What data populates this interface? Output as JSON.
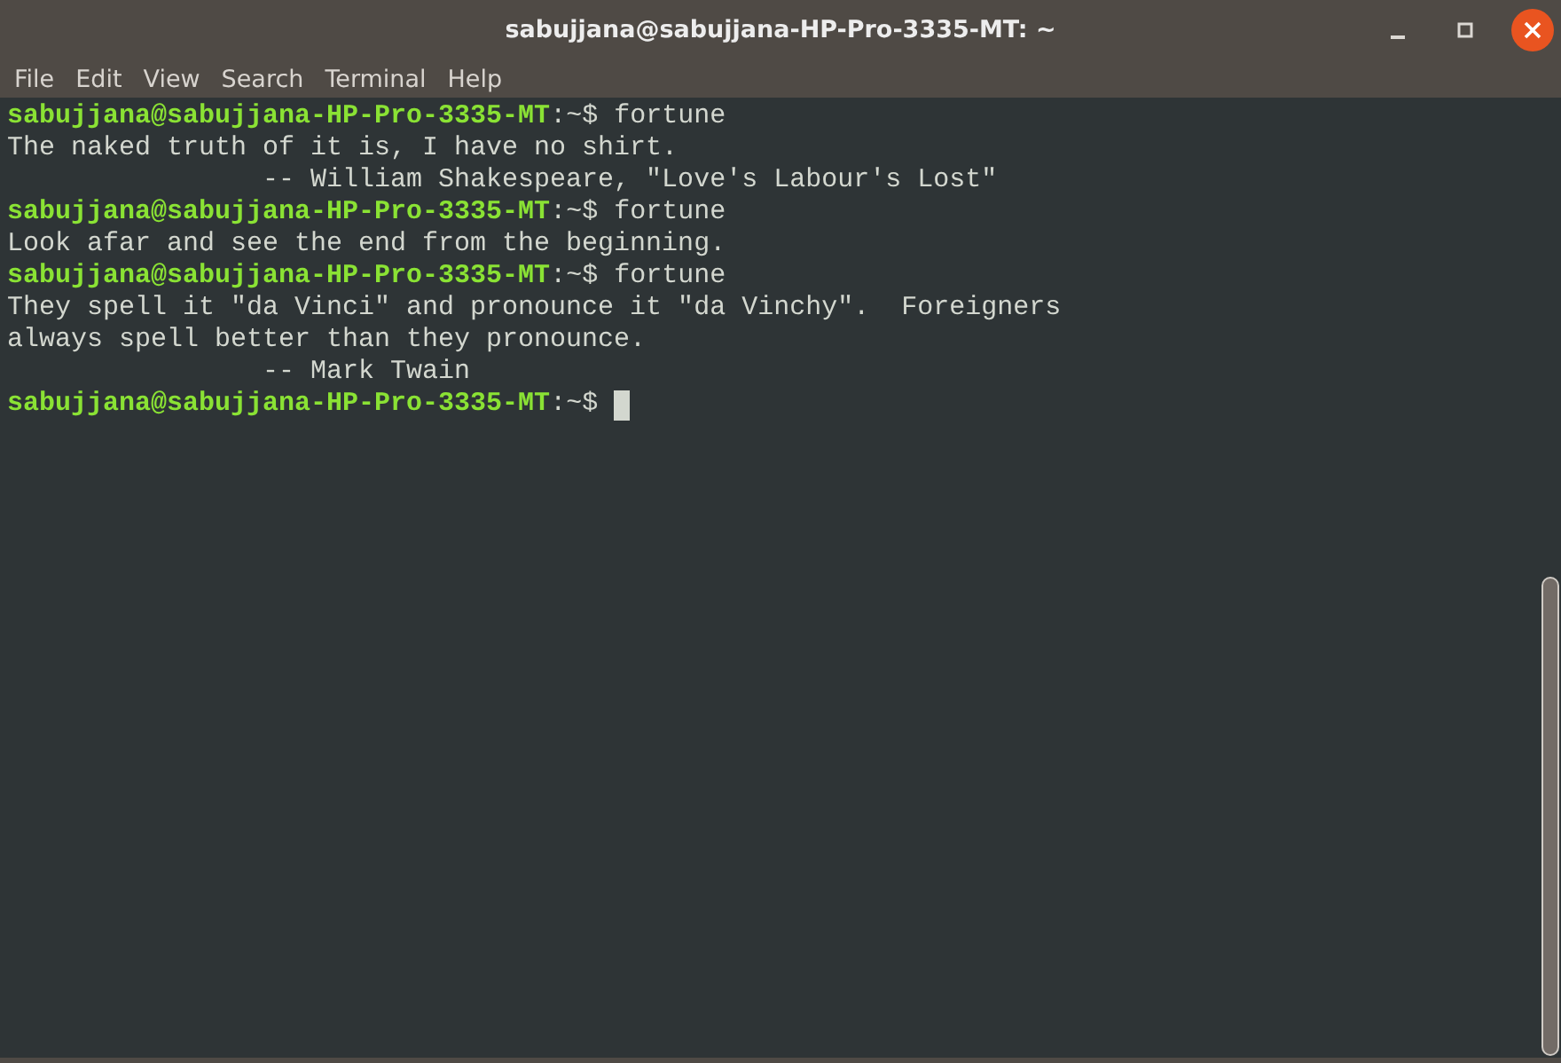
{
  "window": {
    "title": "sabujjana@sabujjana-HP-Pro-3335-MT: ~"
  },
  "menu": [
    "File",
    "Edit",
    "View",
    "Search",
    "Terminal",
    "Help"
  ],
  "lines": [
    {
      "kind": "prompt",
      "user_host": "sabujjana@sabujjana-HP-Pro-3335-MT",
      "path": ":~$",
      "command": "fortune",
      "cursor": false
    },
    {
      "kind": "output",
      "text": "The naked truth of it is, I have no shirt."
    },
    {
      "kind": "output",
      "text": "                -- William Shakespeare, \"Love's Labour's Lost\""
    },
    {
      "kind": "prompt",
      "user_host": "sabujjana@sabujjana-HP-Pro-3335-MT",
      "path": ":~$",
      "command": "fortune",
      "cursor": false
    },
    {
      "kind": "output",
      "text": "Look afar and see the end from the beginning."
    },
    {
      "kind": "prompt",
      "user_host": "sabujjana@sabujjana-HP-Pro-3335-MT",
      "path": ":~$",
      "command": "fortune",
      "cursor": false
    },
    {
      "kind": "output",
      "text": "They spell it \"da Vinci\" and pronounce it \"da Vinchy\".  Foreigners"
    },
    {
      "kind": "output",
      "text": "always spell better than they pronounce."
    },
    {
      "kind": "output",
      "text": "                -- Mark Twain"
    },
    {
      "kind": "prompt",
      "user_host": "sabujjana@sabujjana-HP-Pro-3335-MT",
      "path": ":~$",
      "cursor": true
    }
  ]
}
